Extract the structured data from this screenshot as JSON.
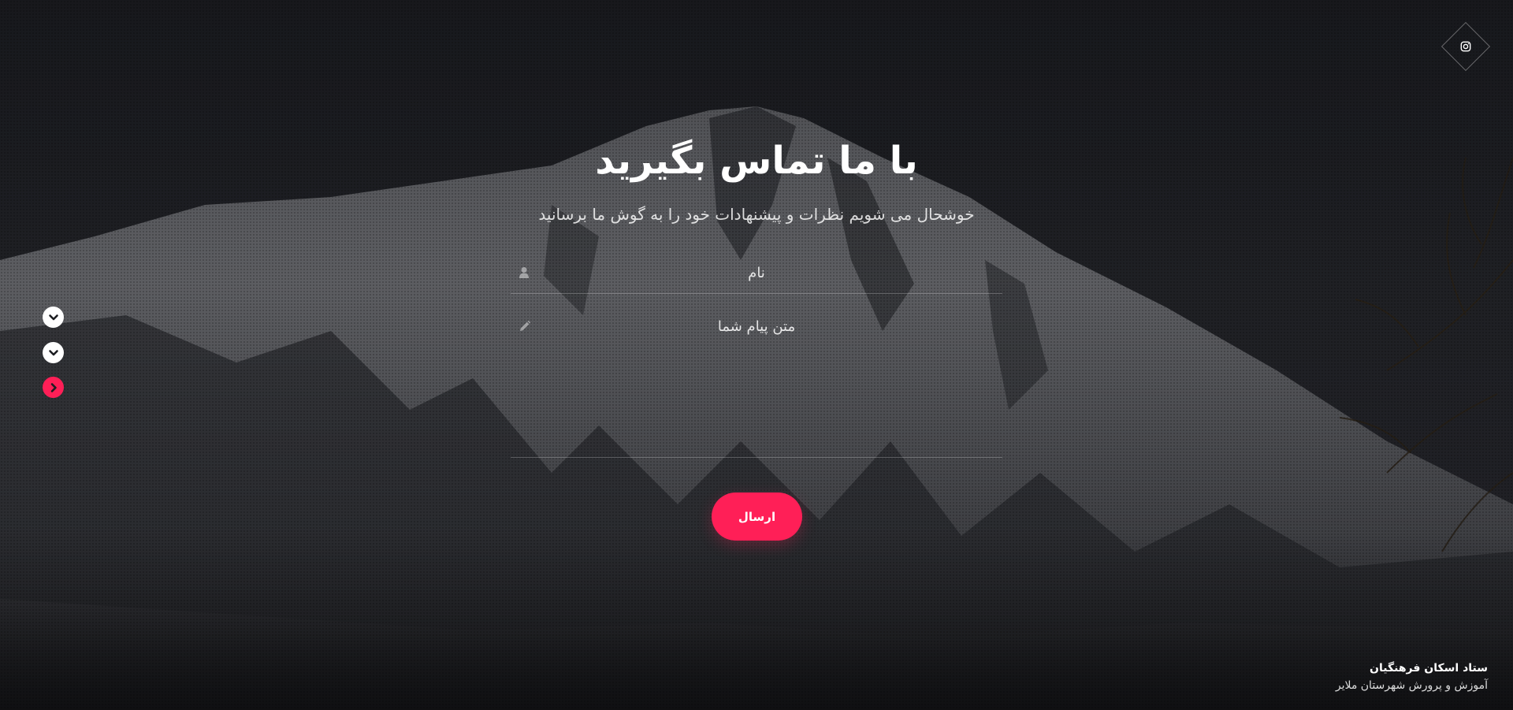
{
  "social": {
    "instagram_icon": "instagram-icon"
  },
  "side_nav": {
    "items": [
      {
        "icon": "chevron-down-icon",
        "active": false
      },
      {
        "icon": "chevron-down-icon",
        "active": false
      },
      {
        "icon": "chevron-right-icon",
        "active": true
      }
    ]
  },
  "contact": {
    "title": "با ما تماس بگیرید",
    "subtitle": "خوشحال می شویم نظرات و پیشنهادات خود را به گوش ما برسانید",
    "name_placeholder": "نام",
    "message_placeholder": "متن پیام شما",
    "send_label": "ارسال"
  },
  "footer": {
    "org_name": "ستاد اسکان فرهنگیان",
    "org_sub": "آموزش و پرورش شهرستان ملایر"
  },
  "colors": {
    "accent": "#ff1f57",
    "background": "#1c1d21",
    "text": "#ffffff"
  }
}
